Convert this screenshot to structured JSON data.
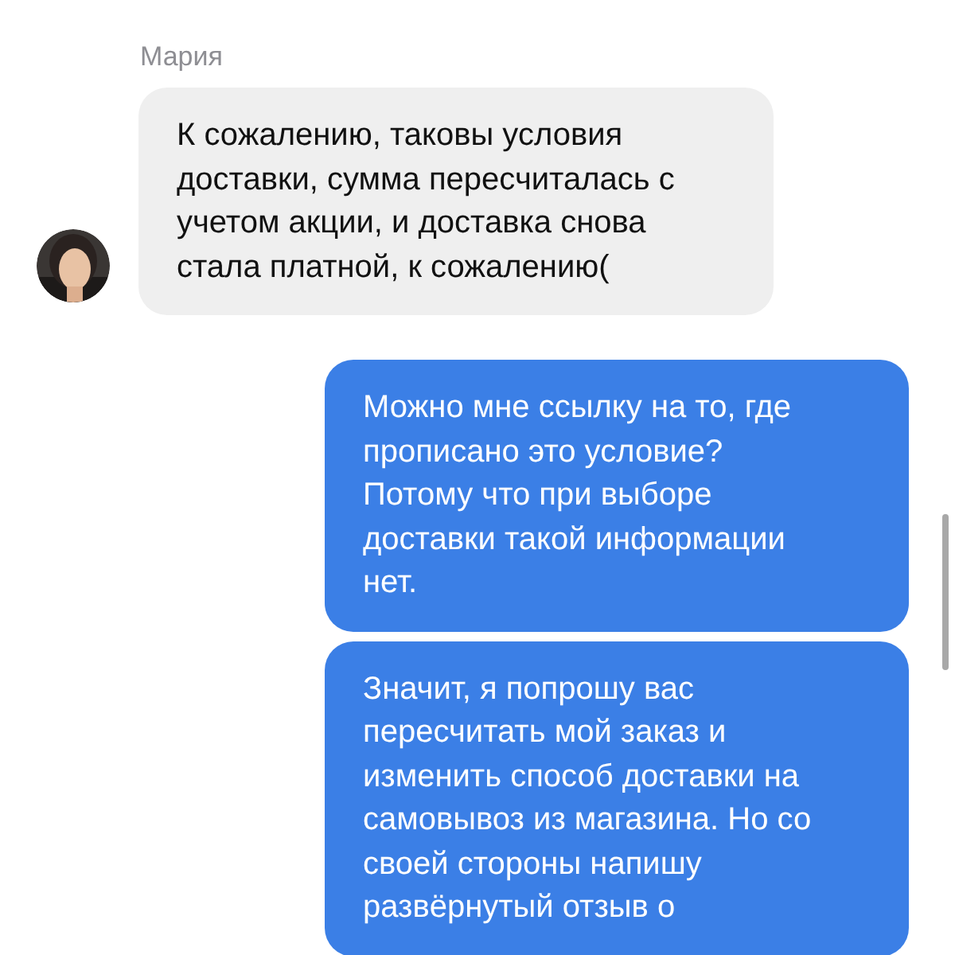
{
  "messages": [
    {
      "kind": "incoming",
      "sender": "Мария",
      "text": "К сожалению, таковы условия доставки, сумма пересчиталась с учетом акции, и доставка снова стала платной, к сожалению("
    },
    {
      "kind": "outgoing",
      "text": "Можно мне ссылку на то, где прописано это условие? Потому что при выборе доставки такой информации нет."
    },
    {
      "kind": "outgoing",
      "text": "Значит, я попрошу вас пересчитать мой заказ и изменить способ доставки на самовывоз из магазина. Но со своей стороны напишу развёрнутый отзыв о"
    }
  ]
}
